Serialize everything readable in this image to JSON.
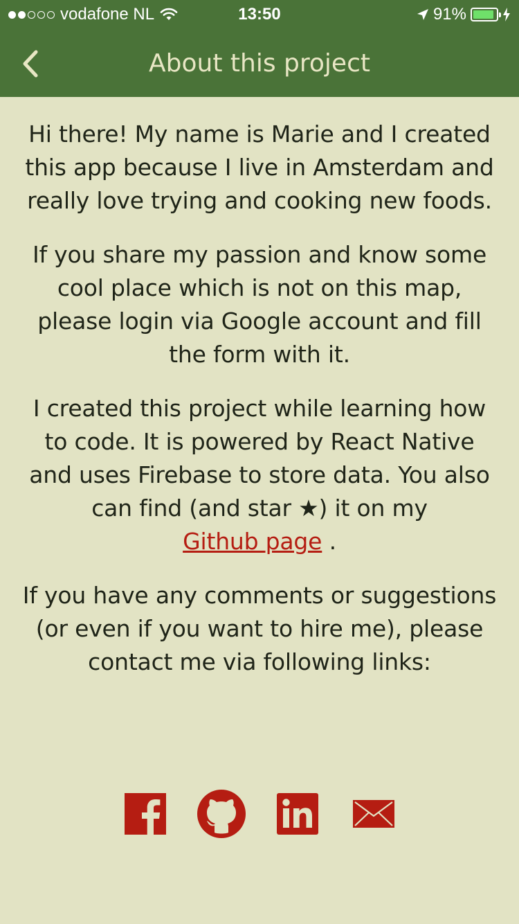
{
  "status_bar": {
    "carrier": "vodafone NL",
    "time": "13:50",
    "battery_percent": "91%",
    "battery_level": 0.91,
    "battery_color": "#6fe06a"
  },
  "header": {
    "title": "About this project",
    "back_icon": "chevron-left-icon",
    "background_color": "#4a7338"
  },
  "content": {
    "paragraph_1": "Hi there! My name is Marie and I created this app because I live in Amsterdam and really love trying and cooking new foods.",
    "paragraph_2": "If you share my passion and know some cool place which is not on this map, please login via Google account and fill the form with it.",
    "paragraph_3_text": "I created this project while learning how to code. It is powered by React Native and uses Firebase to store data. You also can find (and star ★) it on my",
    "paragraph_3_link": "Github page",
    "paragraph_3_end": " .",
    "paragraph_4": "If you have any comments or suggestions (or even if you want to hire me), please contact me via following links:"
  },
  "social_links": [
    {
      "icon": "facebook-icon"
    },
    {
      "icon": "github-icon"
    },
    {
      "icon": "linkedin-icon"
    },
    {
      "icon": "mail-icon"
    }
  ],
  "colors": {
    "background": "#e2e3c4",
    "accent": "#b51d12",
    "header": "#4a7338"
  }
}
